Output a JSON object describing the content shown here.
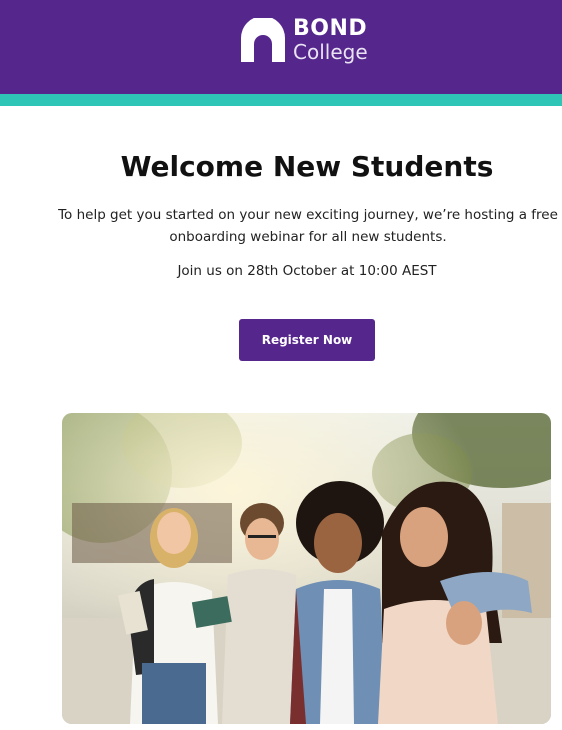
{
  "brand": {
    "logo_line1": "BOND",
    "logo_line2": "College",
    "header_color": "#55268c",
    "accent_color": "#2ec4b6"
  },
  "main": {
    "title": "Welcome New Students",
    "intro": "To help get you started on your new exciting journey, we’re hosting a free onboarding webinar for all new students.",
    "date_line": "Join us on 28th October at 10:00 AEST",
    "register_label": "Register Now"
  }
}
